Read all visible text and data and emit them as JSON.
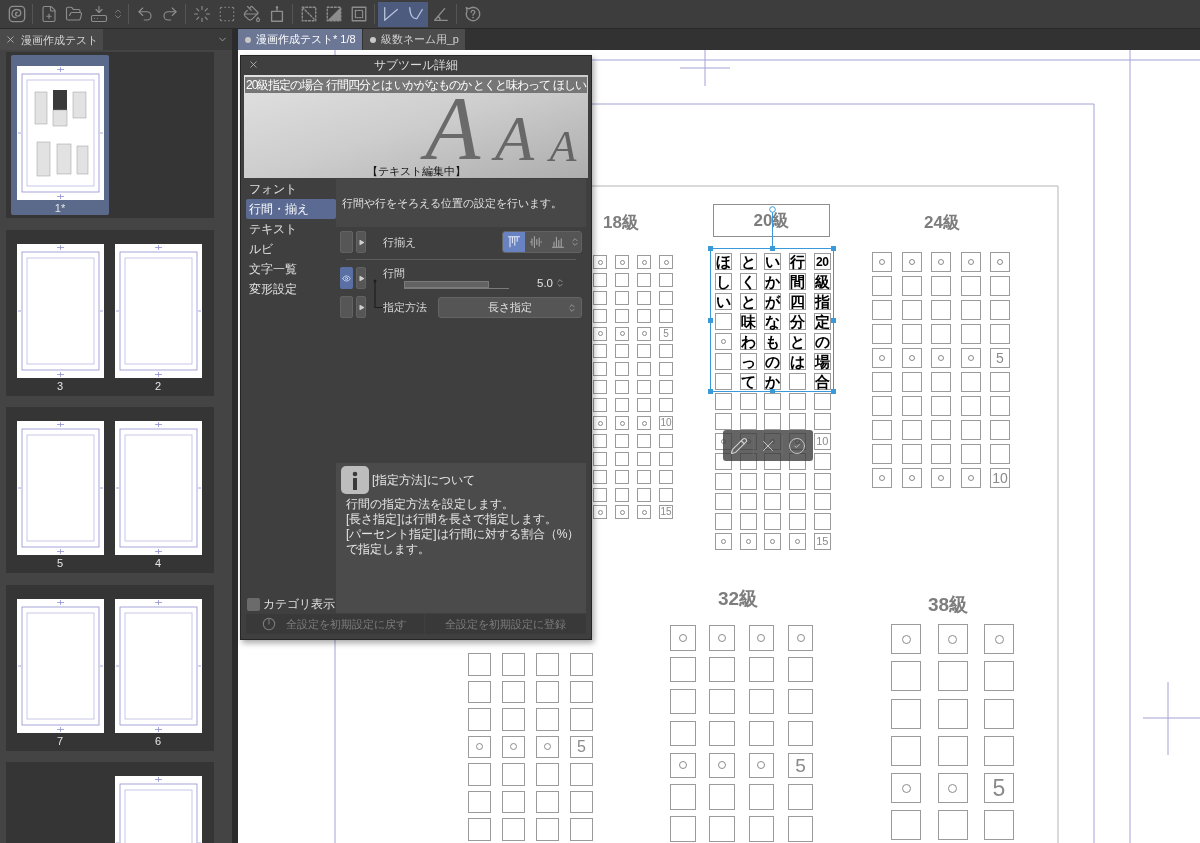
{
  "toolbar": {
    "groups": [
      [
        {
          "selected": false
        }
      ],
      [
        {
          "selected": false
        },
        {
          "selected": false
        },
        {
          "selected": false
        },
        {
          "selected": false
        }
      ],
      [
        {
          "selected": false
        },
        {
          "selected": false
        }
      ],
      [
        {
          "selected": false
        },
        {
          "selected": false
        },
        {
          "selected": false
        },
        {
          "selected": false
        }
      ],
      [
        {
          "selected": false
        },
        {
          "selected": false
        },
        {
          "selected": false
        }
      ],
      [
        {
          "selected": true
        },
        {
          "selected": true
        },
        {
          "selected": false
        }
      ],
      [
        {
          "selected": false
        }
      ]
    ]
  },
  "page_panel": {
    "title": "漫画作成テスト",
    "spreads": [
      {
        "left": {
          "kind": "filled",
          "label": "1*",
          "selected": true
        }
      },
      {
        "left": {
          "kind": "blank",
          "label": "3",
          "selected": false
        },
        "right": {
          "kind": "blank",
          "label": "2",
          "selected": false
        }
      },
      {
        "left": {
          "kind": "blank",
          "label": "5",
          "selected": false
        },
        "right": {
          "kind": "blank",
          "label": "4",
          "selected": false
        }
      },
      {
        "left": {
          "kind": "blank",
          "label": "7",
          "selected": false
        },
        "right": {
          "kind": "blank",
          "label": "6",
          "selected": false
        }
      },
      {
        "right": {
          "kind": "blank",
          "selected": false
        }
      }
    ]
  },
  "tabs": [
    {
      "label": "漫画作成テスト* 1/8",
      "selected": true
    },
    {
      "label": "級数ネーム用_p",
      "selected": false
    }
  ],
  "subtool_panel": {
    "title": "サブツール詳細",
    "preview": {
      "text": "20級指定の場合 行間四分とは いかがなものか とくと味わって ほしい",
      "glyphs": [
        "A",
        "A",
        "A"
      ],
      "status": "【テキスト編集中】"
    },
    "categories": [
      {
        "label": "フォント",
        "selected": false
      },
      {
        "label": "行間・揃え",
        "selected": true
      },
      {
        "label": "テキスト",
        "selected": false
      },
      {
        "label": "ルビ",
        "selected": false
      },
      {
        "label": "文字一覧",
        "selected": false
      },
      {
        "label": "変形設定",
        "selected": false
      }
    ],
    "description": "行間や行をそろえる位置の設定を行います。",
    "settings": [
      {
        "kind": "align",
        "label": "行揃え",
        "eye_on": false,
        "options": [
          {
            "selected": true
          },
          {
            "selected": false
          },
          {
            "selected": false
          }
        ]
      },
      {
        "kind": "slider",
        "label": "行間",
        "eye_on": true,
        "level": 0.81,
        "value": "5.0"
      },
      {
        "kind": "select",
        "label": "指定方法",
        "eye_on": false,
        "value": "長さ指定"
      }
    ],
    "help": {
      "title": "[指定方法]について",
      "lines": [
        "行間の指定方法を設定します。",
        "[長さ指定]は行間を長さで指定します。",
        "[パーセント指定]は行間に対する割合（%）で指定します。"
      ]
    },
    "category_toggle": {
      "label": "カテゴリ表示",
      "checked": false
    },
    "buttons": [
      {
        "label": "全設定を初期設定に戻す",
        "disabled": true
      },
      {
        "label": "全設定を初期設定に登録",
        "disabled": true
      }
    ]
  },
  "canvas": {
    "grids": [
      {
        "title": "18級",
        "framed": false,
        "rows": [
          [
            {
              "kind": "dot"
            },
            {
              "kind": "dot"
            },
            {
              "kind": "dot"
            },
            {
              "kind": "dot"
            }
          ],
          [
            {
              "kind": "box"
            },
            {
              "kind": "box"
            },
            {
              "kind": "box"
            },
            {
              "kind": "box"
            }
          ],
          [
            {
              "kind": "box"
            },
            {
              "kind": "box"
            },
            {
              "kind": "box"
            },
            {
              "kind": "box"
            }
          ],
          [
            {
              "kind": "box"
            },
            {
              "kind": "box"
            },
            {
              "kind": "box"
            },
            {
              "kind": "box"
            }
          ],
          [
            {
              "kind": "dot"
            },
            {
              "kind": "dot"
            },
            {
              "kind": "dot"
            },
            {
              "kind": "number",
              "text": "5"
            }
          ],
          [
            {
              "kind": "box"
            },
            {
              "kind": "box"
            },
            {
              "kind": "box"
            },
            {
              "kind": "box"
            }
          ],
          [
            {
              "kind": "box"
            },
            {
              "kind": "box"
            },
            {
              "kind": "box"
            },
            {
              "kind": "box"
            }
          ],
          [
            {
              "kind": "box"
            },
            {
              "kind": "box"
            },
            {
              "kind": "box"
            },
            {
              "kind": "box"
            }
          ],
          [
            {
              "kind": "box"
            },
            {
              "kind": "box"
            },
            {
              "kind": "box"
            },
            {
              "kind": "box"
            }
          ],
          [
            {
              "kind": "dot"
            },
            {
              "kind": "dot"
            },
            {
              "kind": "dot"
            },
            {
              "kind": "number",
              "text": "10"
            }
          ],
          [
            {
              "kind": "box"
            },
            {
              "kind": "box"
            },
            {
              "kind": "box"
            },
            {
              "kind": "box"
            }
          ],
          [
            {
              "kind": "box"
            },
            {
              "kind": "box"
            },
            {
              "kind": "box"
            },
            {
              "kind": "box"
            }
          ],
          [
            {
              "kind": "box"
            },
            {
              "kind": "box"
            },
            {
              "kind": "box"
            },
            {
              "kind": "box"
            }
          ],
          [
            {
              "kind": "box"
            },
            {
              "kind": "box"
            },
            {
              "kind": "box"
            },
            {
              "kind": "box"
            }
          ],
          [
            {
              "kind": "dot"
            },
            {
              "kind": "dot"
            },
            {
              "kind": "dot"
            },
            {
              "kind": "number",
              "text": "15"
            }
          ]
        ]
      },
      {
        "title": "20級",
        "framed": true,
        "text_columns": [
          {
            "text": "ほしい",
            "cells": [
              {
                "kind": "box"
              },
              {
                "kind": "dot"
              },
              {
                "kind": "box"
              },
              {
                "kind": "box"
              }
            ]
          },
          {
            "text": "とくと味わって"
          },
          {
            "text": "いかがなものか"
          },
          {
            "text": "行間四分とは",
            "cells": [
              {
                "kind": "box"
              }
            ]
          },
          {
            "text": "20級指定の場合"
          }
        ],
        "rows": [
          [
            {
              "kind": "box"
            },
            {
              "kind": "box"
            },
            {
              "kind": "box"
            },
            {
              "kind": "box"
            },
            {
              "kind": "box"
            }
          ],
          [
            {
              "kind": "box"
            },
            {
              "kind": "box"
            },
            {
              "kind": "box"
            },
            {
              "kind": "box"
            },
            {
              "kind": "box"
            }
          ],
          [
            {
              "kind": "dot"
            },
            {
              "kind": "dot"
            },
            {
              "kind": "dot"
            },
            {
              "kind": "dot"
            },
            {
              "kind": "number",
              "text": "10"
            }
          ],
          [
            {
              "kind": "box"
            },
            {
              "kind": "box"
            },
            {
              "kind": "box"
            },
            {
              "kind": "box"
            },
            {
              "kind": "box"
            }
          ],
          [
            {
              "kind": "box"
            },
            {
              "kind": "box"
            },
            {
              "kind": "box"
            },
            {
              "kind": "box"
            },
            {
              "kind": "box"
            }
          ],
          [
            {
              "kind": "box"
            },
            {
              "kind": "box"
            },
            {
              "kind": "box"
            },
            {
              "kind": "box"
            },
            {
              "kind": "box"
            }
          ],
          [
            {
              "kind": "box"
            },
            {
              "kind": "box"
            },
            {
              "kind": "box"
            },
            {
              "kind": "box"
            },
            {
              "kind": "box"
            }
          ],
          [
            {
              "kind": "dot"
            },
            {
              "kind": "dot"
            },
            {
              "kind": "dot"
            },
            {
              "kind": "dot"
            },
            {
              "kind": "number",
              "text": "15"
            }
          ]
        ]
      },
      {
        "title": "24級",
        "framed": false,
        "rows": [
          [
            {
              "kind": "dot"
            },
            {
              "kind": "dot"
            },
            {
              "kind": "dot"
            },
            {
              "kind": "dot"
            },
            {
              "kind": "dot"
            }
          ],
          [
            {
              "kind": "box"
            },
            {
              "kind": "box"
            },
            {
              "kind": "box"
            },
            {
              "kind": "box"
            },
            {
              "kind": "box"
            }
          ],
          [
            {
              "kind": "box"
            },
            {
              "kind": "box"
            },
            {
              "kind": "box"
            },
            {
              "kind": "box"
            },
            {
              "kind": "box"
            }
          ],
          [
            {
              "kind": "box"
            },
            {
              "kind": "box"
            },
            {
              "kind": "box"
            },
            {
              "kind": "box"
            },
            {
              "kind": "box"
            }
          ],
          [
            {
              "kind": "dot"
            },
            {
              "kind": "dot"
            },
            {
              "kind": "dot"
            },
            {
              "kind": "dot"
            },
            {
              "kind": "number",
              "text": "5"
            }
          ],
          [
            {
              "kind": "box"
            },
            {
              "kind": "box"
            },
            {
              "kind": "box"
            },
            {
              "kind": "box"
            },
            {
              "kind": "box"
            }
          ],
          [
            {
              "kind": "box"
            },
            {
              "kind": "box"
            },
            {
              "kind": "box"
            },
            {
              "kind": "box"
            },
            {
              "kind": "box"
            }
          ],
          [
            {
              "kind": "box"
            },
            {
              "kind": "box"
            },
            {
              "kind": "box"
            },
            {
              "kind": "box"
            },
            {
              "kind": "box"
            }
          ],
          [
            {
              "kind": "box"
            },
            {
              "kind": "box"
            },
            {
              "kind": "box"
            },
            {
              "kind": "box"
            },
            {
              "kind": "box"
            }
          ],
          [
            {
              "kind": "dot"
            },
            {
              "kind": "dot"
            },
            {
              "kind": "dot"
            },
            {
              "kind": "dot"
            },
            {
              "kind": "number",
              "text": "10"
            }
          ]
        ]
      },
      {
        "rows": [
          [
            {
              "kind": "box"
            },
            {
              "kind": "box"
            },
            {
              "kind": "box"
            },
            {
              "kind": "box"
            }
          ],
          [
            {
              "kind": "box"
            },
            {
              "kind": "box"
            },
            {
              "kind": "box"
            },
            {
              "kind": "box"
            }
          ],
          [
            {
              "kind": "box"
            },
            {
              "kind": "box"
            },
            {
              "kind": "box"
            },
            {
              "kind": "box"
            }
          ],
          [
            {
              "kind": "dot"
            },
            {
              "kind": "dot"
            },
            {
              "kind": "dot"
            },
            {
              "kind": "number",
              "text": "5"
            }
          ],
          [
            {
              "kind": "box"
            },
            {
              "kind": "box"
            },
            {
              "kind": "box"
            },
            {
              "kind": "box"
            }
          ],
          [
            {
              "kind": "box"
            },
            {
              "kind": "box"
            },
            {
              "kind": "box"
            },
            {
              "kind": "box"
            }
          ],
          [
            {
              "kind": "box"
            },
            {
              "kind": "box"
            },
            {
              "kind": "box"
            },
            {
              "kind": "box"
            }
          ]
        ]
      },
      {
        "title": "32級",
        "framed": false,
        "rows": [
          [
            {
              "kind": "dot"
            },
            {
              "kind": "dot"
            },
            {
              "kind": "dot"
            },
            {
              "kind": "dot"
            }
          ],
          [
            {
              "kind": "box"
            },
            {
              "kind": "box"
            },
            {
              "kind": "box"
            },
            {
              "kind": "box"
            }
          ],
          [
            {
              "kind": "box"
            },
            {
              "kind": "box"
            },
            {
              "kind": "box"
            },
            {
              "kind": "box"
            }
          ],
          [
            {
              "kind": "box"
            },
            {
              "kind": "box"
            },
            {
              "kind": "box"
            },
            {
              "kind": "box"
            }
          ],
          [
            {
              "kind": "dot"
            },
            {
              "kind": "dot"
            },
            {
              "kind": "dot"
            },
            {
              "kind": "number",
              "text": "5"
            }
          ],
          [
            {
              "kind": "box"
            },
            {
              "kind": "box"
            },
            {
              "kind": "box"
            },
            {
              "kind": "box"
            }
          ],
          [
            {
              "kind": "box"
            },
            {
              "kind": "box"
            },
            {
              "kind": "box"
            },
            {
              "kind": "box"
            }
          ]
        ]
      },
      {
        "title": "38級",
        "framed": false,
        "rows": [
          [
            {
              "kind": "dot"
            },
            {
              "kind": "dot"
            },
            {
              "kind": "dot"
            }
          ],
          [
            {
              "kind": "box"
            },
            {
              "kind": "box"
            },
            {
              "kind": "box"
            }
          ],
          [
            {
              "kind": "box"
            },
            {
              "kind": "box"
            },
            {
              "kind": "box"
            }
          ],
          [
            {
              "kind": "box"
            },
            {
              "kind": "box"
            },
            {
              "kind": "box"
            }
          ],
          [
            {
              "kind": "dot"
            },
            {
              "kind": "dot"
            },
            {
              "kind": "number",
              "text": "5"
            }
          ],
          [
            {
              "kind": "box"
            },
            {
              "kind": "box"
            },
            {
              "kind": "box"
            }
          ]
        ]
      }
    ]
  }
}
